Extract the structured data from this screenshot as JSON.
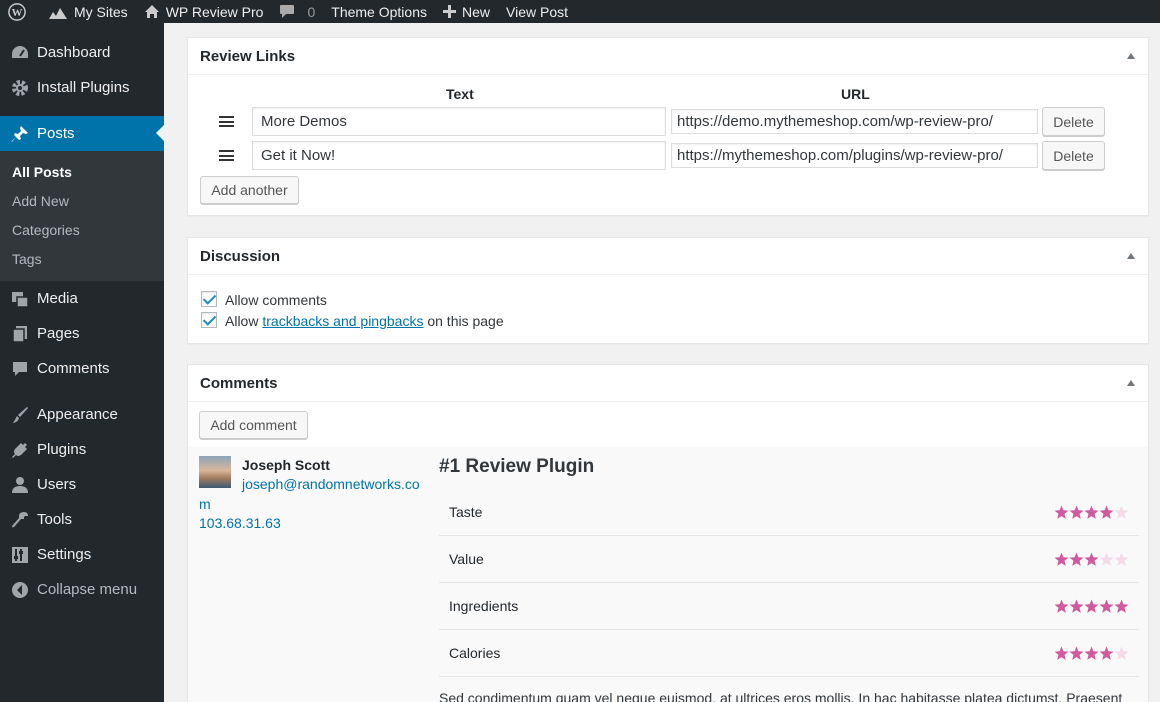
{
  "adminbar": {
    "my_sites": "My Sites",
    "site_name": "WP Review Pro",
    "comments_count": "0",
    "theme_options": "Theme Options",
    "new": "New",
    "view_post": "View Post"
  },
  "sidebar": {
    "items": [
      {
        "label": "Dashboard",
        "icon": "dashboard-icon"
      },
      {
        "label": "Install Plugins",
        "icon": "gear-icon"
      },
      {
        "label": "Posts",
        "icon": "pin-icon",
        "current": true
      },
      {
        "label": "Media",
        "icon": "media-icon"
      },
      {
        "label": "Pages",
        "icon": "pages-icon"
      },
      {
        "label": "Comments",
        "icon": "comment-icon"
      },
      {
        "label": "Appearance",
        "icon": "brush-icon"
      },
      {
        "label": "Plugins",
        "icon": "plug-icon"
      },
      {
        "label": "Users",
        "icon": "user-icon"
      },
      {
        "label": "Tools",
        "icon": "wrench-icon"
      },
      {
        "label": "Settings",
        "icon": "settings-icon"
      }
    ],
    "submenu": [
      "All Posts",
      "Add New",
      "Categories",
      "Tags"
    ],
    "collapse": "Collapse menu"
  },
  "review_links": {
    "title": "Review Links",
    "col_text": "Text",
    "col_url": "URL",
    "rows": [
      {
        "text": "More Demos",
        "url": "https://demo.mythemeshop.com/wp-review-pro/",
        "delete": "Delete"
      },
      {
        "text": "Get it Now!",
        "url": "https://mythemeshop.com/plugins/wp-review-pro/",
        "delete": "Delete"
      }
    ],
    "add_another": "Add another"
  },
  "discussion": {
    "title": "Discussion",
    "allow_comments": "Allow comments",
    "allow_prefix": "Allow",
    "trackbacks_link": "trackbacks and pingbacks",
    "allow_suffix": "on this page"
  },
  "comments": {
    "title": "Comments",
    "add_comment": "Add comment",
    "author": "Joseph Scott",
    "email_line1": "joseph@randomnetworks.co",
    "email_line2": "m",
    "ip": "103.68.31.63",
    "review_title": "#1 Review Plugin",
    "criteria": [
      {
        "label": "Taste",
        "rating": 4,
        "max": 5
      },
      {
        "label": "Value",
        "rating": 3,
        "max": 5
      },
      {
        "label": "Ingredients",
        "rating": 5,
        "max": 5
      },
      {
        "label": "Calories",
        "rating": 4,
        "max": 5
      }
    ],
    "review_text": "Sed condimentum quam vel neque euismod, at ultrices eros mollis. In hac habitasse platea dictumst. Praesent"
  },
  "colors": {
    "star_filled": "#d05a9c",
    "star_empty": "#f3dbe8",
    "accent": "#0073aa"
  }
}
